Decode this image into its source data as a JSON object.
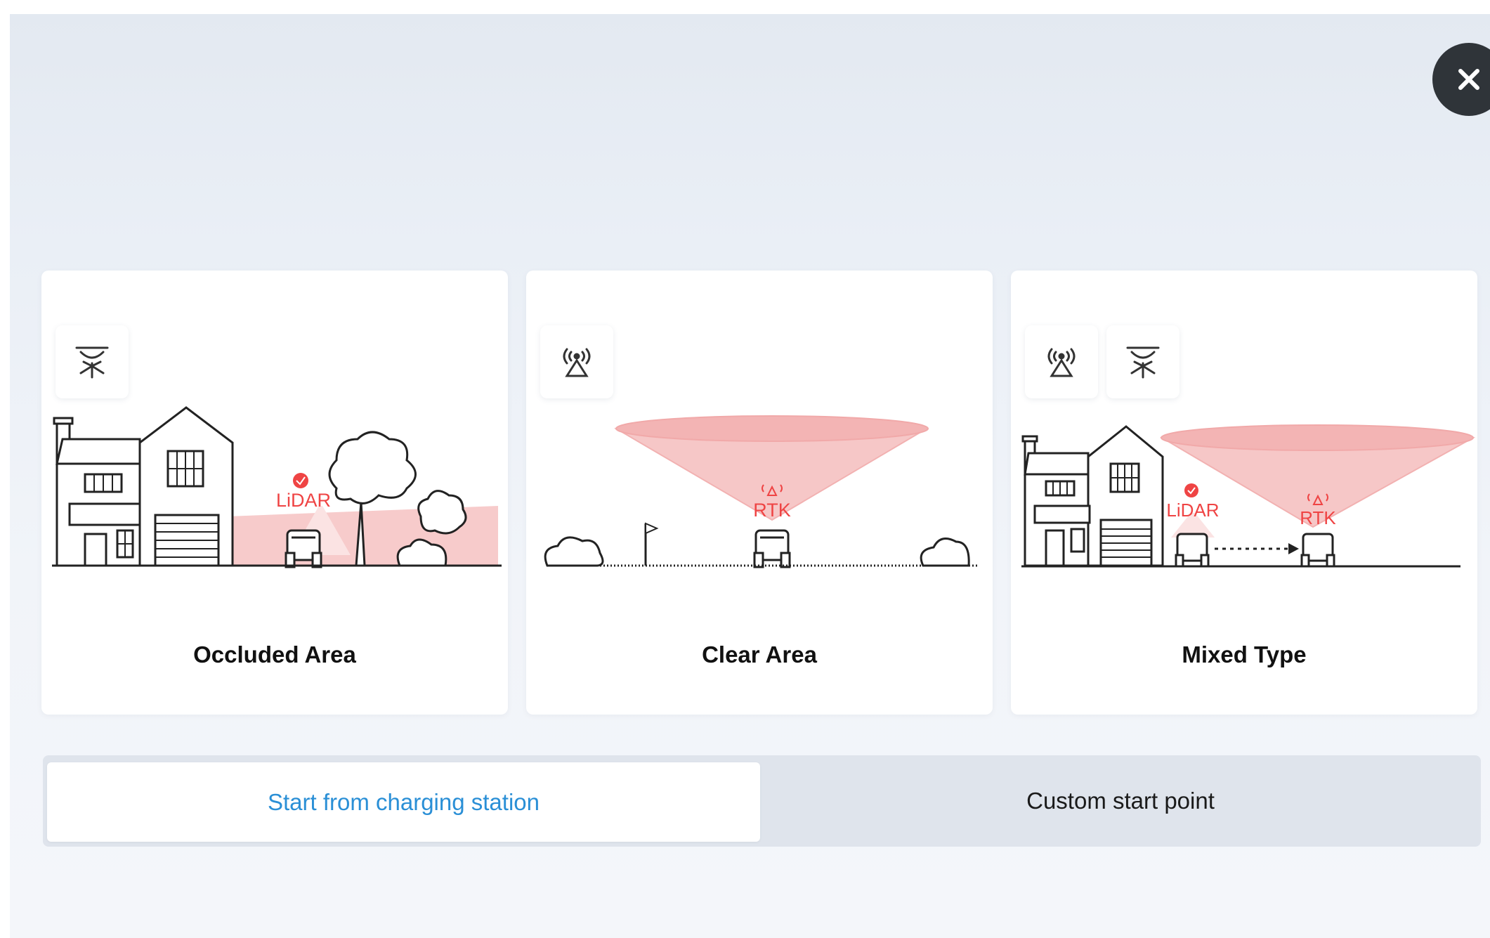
{
  "close": {
    "icon": "close-icon"
  },
  "cards": [
    {
      "title": "Occluded Area",
      "icons": [
        "lidar-icon"
      ],
      "labels": [
        "LiDAR"
      ]
    },
    {
      "title": "Clear Area",
      "icons": [
        "rtk-antenna-icon"
      ],
      "labels": [
        "RTK"
      ]
    },
    {
      "title": "Mixed Type",
      "icons": [
        "rtk-antenna-icon",
        "lidar-icon"
      ],
      "labels": [
        "LiDAR",
        "RTK"
      ]
    }
  ],
  "start_point": {
    "options": [
      "Start from charging station",
      "Custom start point"
    ],
    "selected": "Start from charging station"
  },
  "colors": {
    "accent_blue": "#2a8fd6",
    "sensor_red": "#ef4444",
    "cone_fill": "#f6c2c2",
    "close_bg": "#2f3439"
  }
}
